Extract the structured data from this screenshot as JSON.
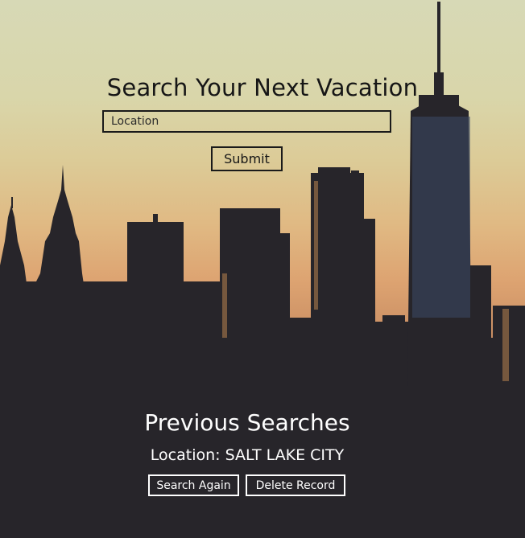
{
  "search": {
    "title": "Search Your Next Vacation",
    "placeholder": "Location",
    "submit_label": "Submit"
  },
  "previous": {
    "title": "Previous Searches",
    "location_text": "Location: SALT LAKE CITY",
    "search_again_label": "Search Again",
    "delete_label": "Delete Record"
  },
  "colors": {
    "dark_text": "#161616",
    "light_text": "#ffffff",
    "skyline": "#262427"
  }
}
